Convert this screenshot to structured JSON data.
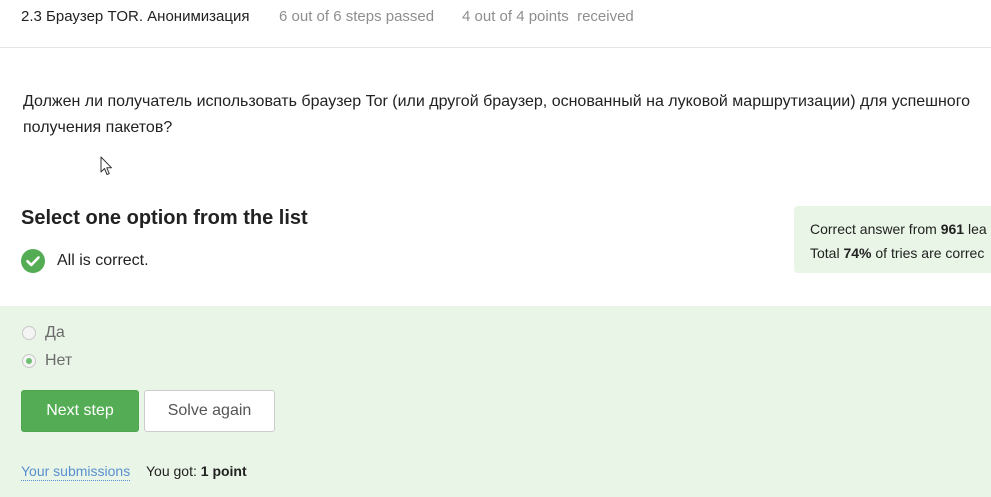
{
  "header": {
    "lesson_title": "2.3 Браузер TOR. Анонимизация",
    "steps_status": "6 out of 6 steps passed",
    "points_status": "4 out of 4 points  received"
  },
  "question": {
    "text": "Должен ли получатель использовать браузер Tor (или другой браузер, основанный на луковой маршрутизации) для успешного получения пакетов?"
  },
  "quiz": {
    "heading": "Select one option from the list",
    "result_text": "All is correct.",
    "result_icon": "check-circle-icon",
    "options": [
      {
        "label": "Да",
        "checked": false
      },
      {
        "label": "Нет",
        "checked": true
      }
    ]
  },
  "stats": {
    "line1_prefix": "Correct answer from ",
    "line1_count": "961",
    "line1_suffix": " lea",
    "line2_prefix": "Total ",
    "line2_percent": "74%",
    "line2_suffix": " of tries are correc"
  },
  "actions": {
    "next_label": "Next step",
    "solve_again_label": "Solve again",
    "submissions_label": "Your submissions",
    "score_prefix": "You got: ",
    "score_value": "1 point"
  },
  "colors": {
    "accent_green": "#54ad54",
    "panel_green": "#e9f5e6",
    "link_blue": "#5a8fd0"
  }
}
